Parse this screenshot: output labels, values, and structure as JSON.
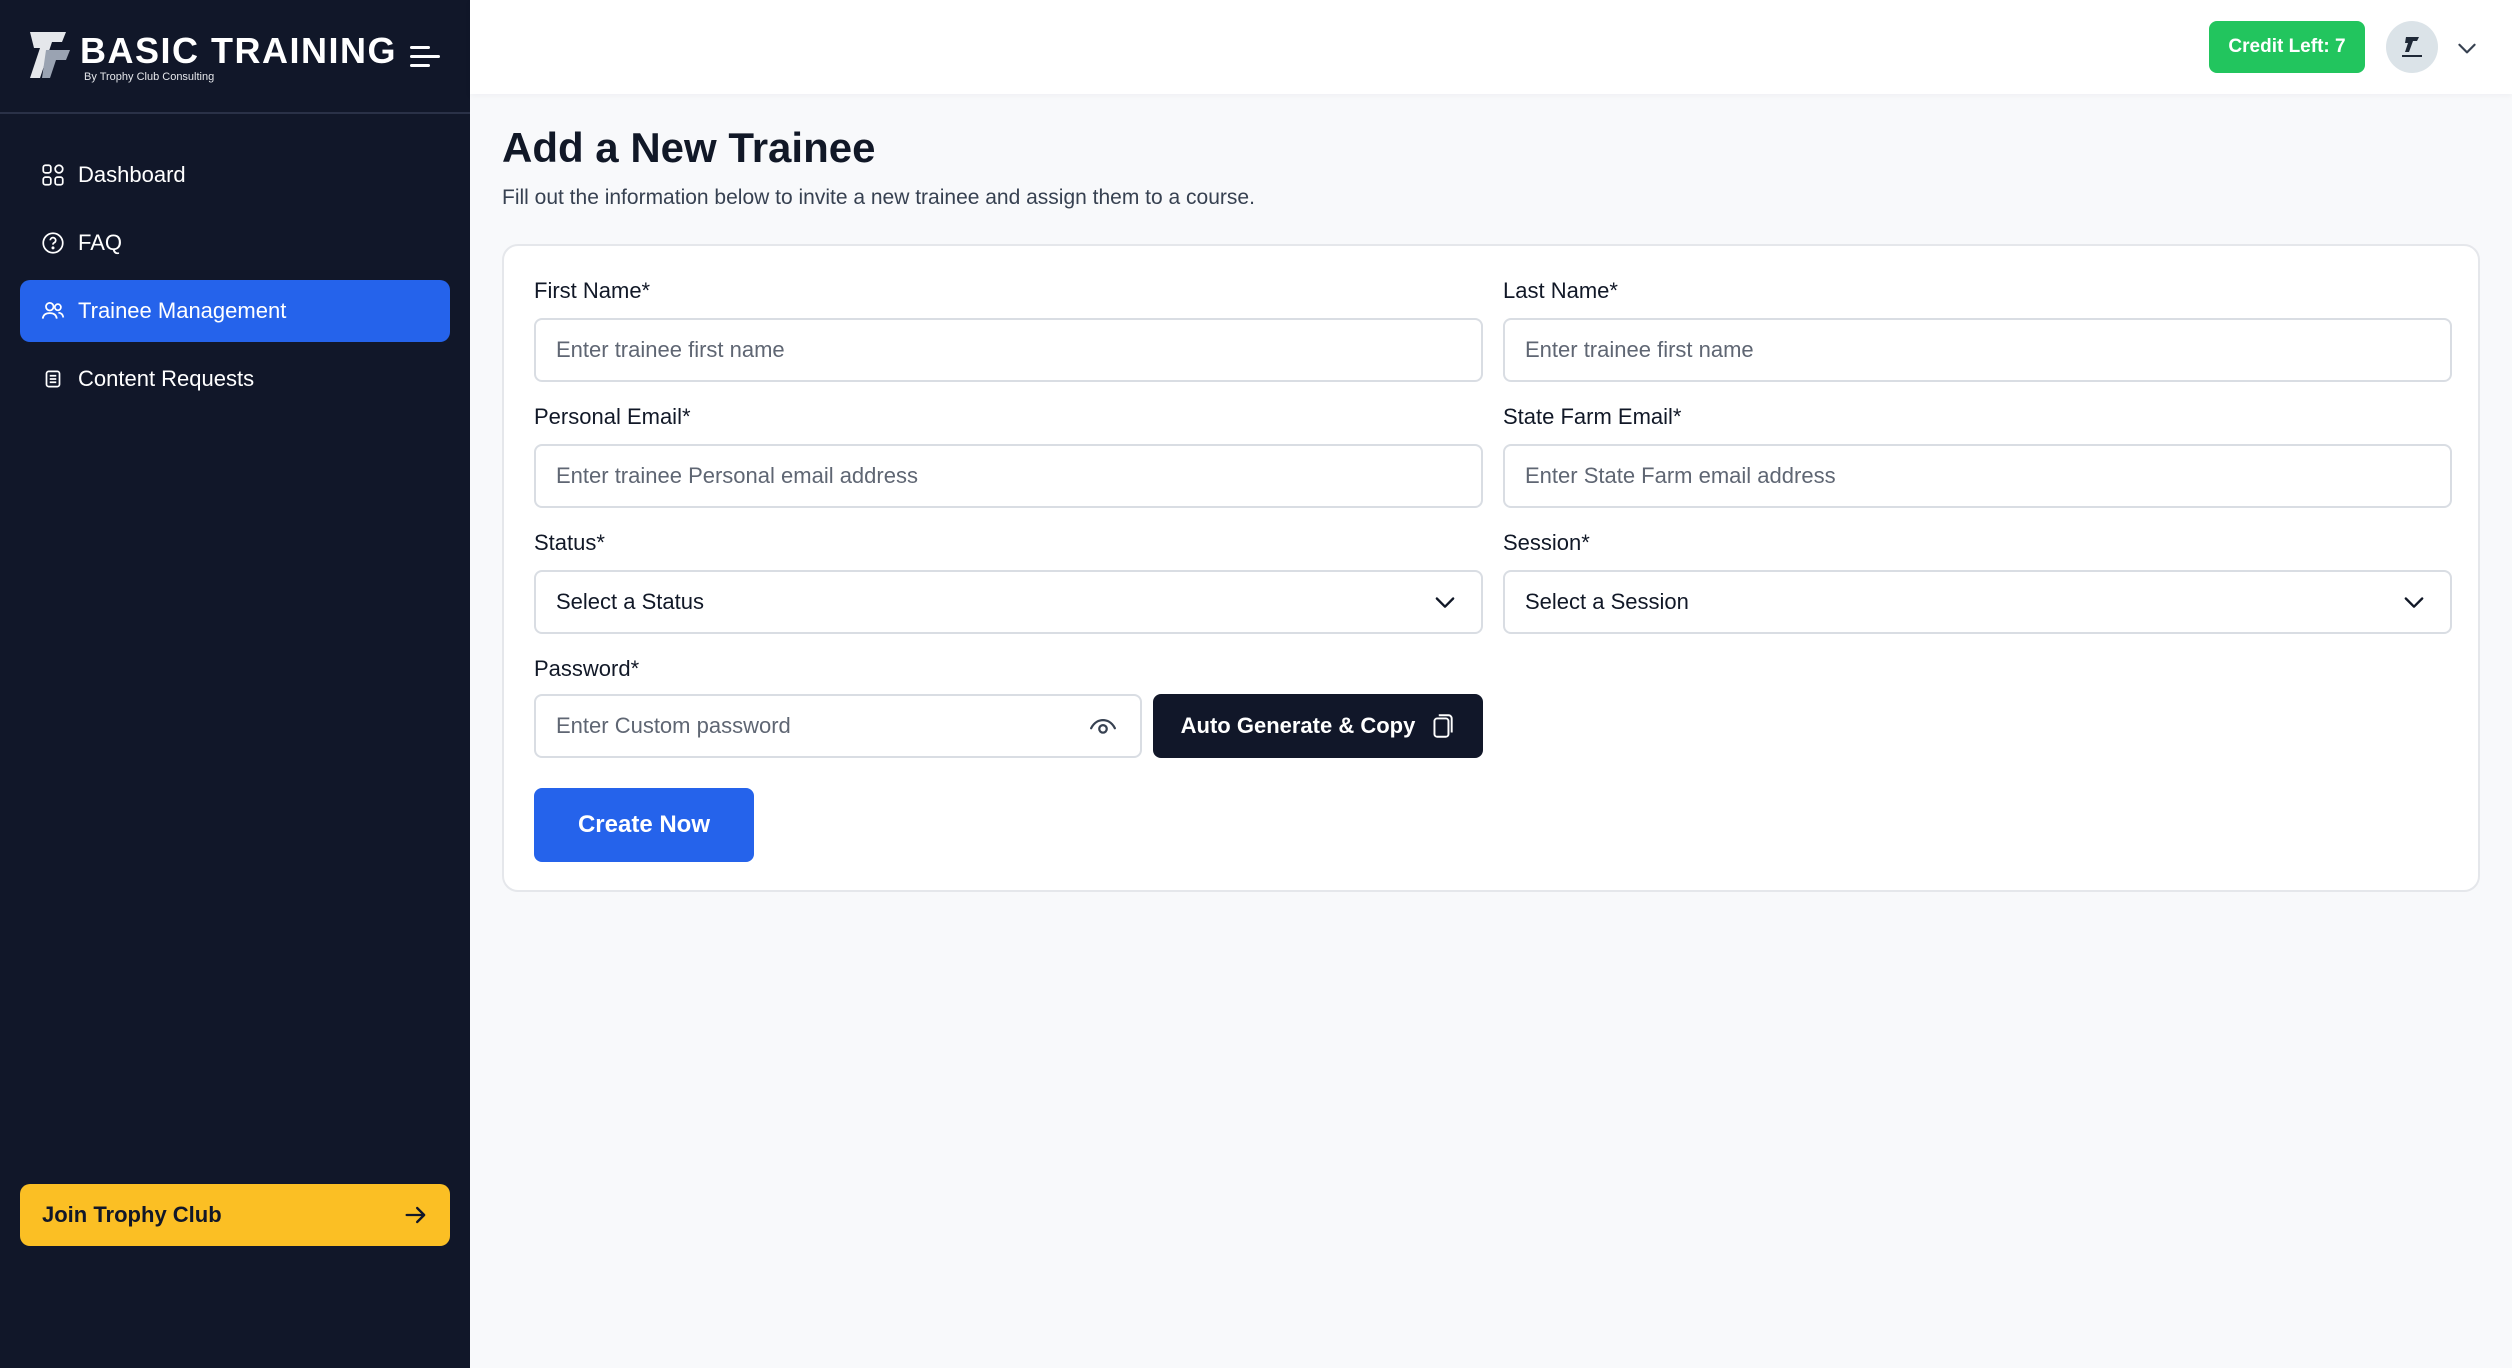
{
  "brand": {
    "title": "BASIC TRAINING",
    "subtitle": "By Trophy Club Consulting"
  },
  "sidebar": {
    "items": [
      {
        "label": "Dashboard",
        "icon": "grid-icon",
        "active": false
      },
      {
        "label": "FAQ",
        "icon": "question-circle-icon",
        "active": false
      },
      {
        "label": "Trainee Management",
        "icon": "users-icon",
        "active": true
      },
      {
        "label": "Content Requests",
        "icon": "document-list-icon",
        "active": false
      }
    ],
    "join_label": "Join Trophy Club"
  },
  "header": {
    "credit_label": "Credit Left: 7"
  },
  "page": {
    "title": "Add a New Trainee",
    "subtitle": "Fill out the information below to invite a new trainee and assign them to a course."
  },
  "form": {
    "first_name": {
      "label": "First Name*",
      "placeholder": "Enter trainee first name",
      "value": ""
    },
    "last_name": {
      "label": "Last Name*",
      "placeholder": "Enter trainee first name",
      "value": ""
    },
    "personal_email": {
      "label": "Personal Email*",
      "placeholder": "Enter trainee Personal email address",
      "value": ""
    },
    "state_farm_email": {
      "label": "State Farm Email*",
      "placeholder": "Enter State Farm email address",
      "value": ""
    },
    "status": {
      "label": "Status*",
      "selected": "Select a Status"
    },
    "session": {
      "label": "Session*",
      "selected": "Select a Session"
    },
    "password": {
      "label": "Password*",
      "placeholder": "Enter Custom password",
      "value": ""
    },
    "generate_label": "Auto Generate & Copy",
    "submit_label": "Create Now"
  },
  "colors": {
    "sidebar_bg": "#111729",
    "accent": "#2563eb",
    "credit": "#22c55e",
    "join": "#fbbf24"
  }
}
